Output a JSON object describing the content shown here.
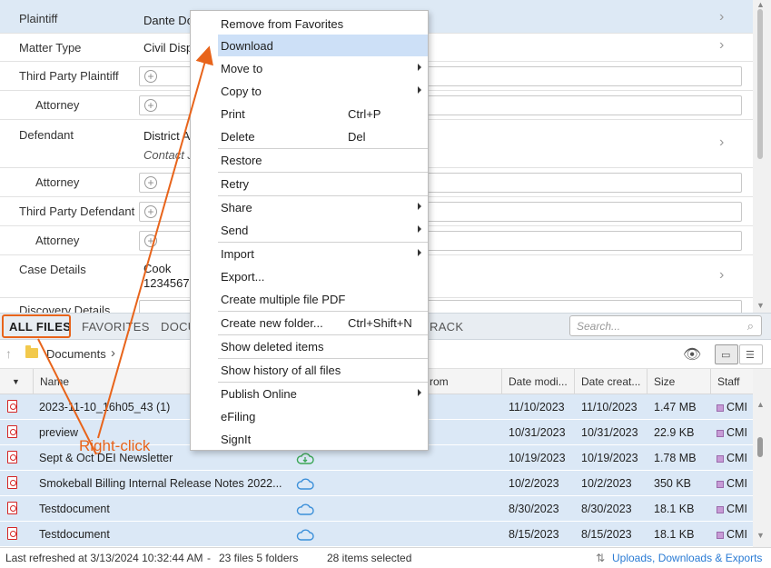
{
  "matter": {
    "rows": [
      {
        "label": "Plaintiff",
        "value": "Dante Do"
      },
      {
        "label": "Matter Type",
        "value": "Civil Disp"
      },
      {
        "label": "Third Party Plaintiff"
      },
      {
        "label": "Attorney"
      },
      {
        "label": "Defendant",
        "value": "District A",
        "value2": "Contact J"
      },
      {
        "label": "Attorney"
      },
      {
        "label": "Third Party Defendant"
      },
      {
        "label": "Attorney"
      },
      {
        "label": "Case Details",
        "value": "Cook",
        "value2": "12345678"
      },
      {
        "label": "Discovery Details"
      }
    ]
  },
  "tabs": {
    "all_files": "ALL FILES",
    "favorites": "FAVORITES",
    "documents": "DOCU",
    "track": "RACK"
  },
  "search": {
    "placeholder": "Search..."
  },
  "breadcrumb": {
    "folder": "Documents"
  },
  "table": {
    "columns": [
      "Name",
      "rom",
      "Date modi...",
      "Date creat...",
      "Size",
      "Staff"
    ],
    "rows": [
      {
        "name": "2023-11-10_16h05_43 (1)",
        "modified": "11/10/2023",
        "created": "11/10/2023",
        "size": "1.47 MB",
        "staff": "CMI",
        "sync": ""
      },
      {
        "name": "preview",
        "modified": "10/31/2023",
        "created": "10/31/2023",
        "size": "22.9 KB",
        "staff": "CMI",
        "sync": ""
      },
      {
        "name": "Sept & Oct DEI Newsletter",
        "modified": "10/19/2023",
        "created": "10/19/2023",
        "size": "1.78 MB",
        "staff": "CMI",
        "sync": "synced"
      },
      {
        "name": "Smokeball Billing Internal Release Notes 2022...",
        "modified": "10/2/2023",
        "created": "10/2/2023",
        "size": "350 KB",
        "staff": "CMI",
        "sync": "cloud"
      },
      {
        "name": "Testdocument",
        "modified": "8/30/2023",
        "created": "8/30/2023",
        "size": "18.1 KB",
        "staff": "CMI",
        "sync": "cloud"
      },
      {
        "name": "Testdocument",
        "modified": "8/15/2023",
        "created": "8/15/2023",
        "size": "18.1 KB",
        "staff": "CMI",
        "sync": "cloud"
      }
    ]
  },
  "status": {
    "refreshed": "Last refreshed at 3/13/2024 10:32:44 AM",
    "sep": "-",
    "counts": "23 files  5 folders",
    "selected": "28 items selected",
    "uploads": "Uploads, Downloads & Exports"
  },
  "context_menu": {
    "items": [
      {
        "label": "Remove from Favorites"
      },
      {
        "label": "Download",
        "highlighted": true
      },
      {
        "label": "Move to",
        "submenu": true
      },
      {
        "label": "Copy to",
        "submenu": true
      },
      {
        "label": "Print",
        "shortcut": "Ctrl+P"
      },
      {
        "label": "Delete",
        "shortcut": "Del"
      },
      {
        "label": "Restore"
      },
      {
        "label": "Retry"
      },
      {
        "label": "Share",
        "submenu": true
      },
      {
        "label": "Send",
        "submenu": true
      },
      {
        "label": "Import",
        "submenu": true
      },
      {
        "label": "Export..."
      },
      {
        "label": "Create multiple file PDF"
      },
      {
        "label": "Create new folder...",
        "shortcut": "Ctrl+Shift+N"
      },
      {
        "label": "Show deleted items"
      },
      {
        "label": "Show history of all files"
      },
      {
        "label": "Publish Online",
        "submenu": true
      },
      {
        "label": "eFiling"
      },
      {
        "label": "SignIt"
      }
    ]
  },
  "annotation": {
    "text": "Right-click",
    "color": "#e8641b"
  },
  "colors": {
    "accent": "#e8641b",
    "selection": "#dbe8f6",
    "link": "#2a7bd4"
  }
}
